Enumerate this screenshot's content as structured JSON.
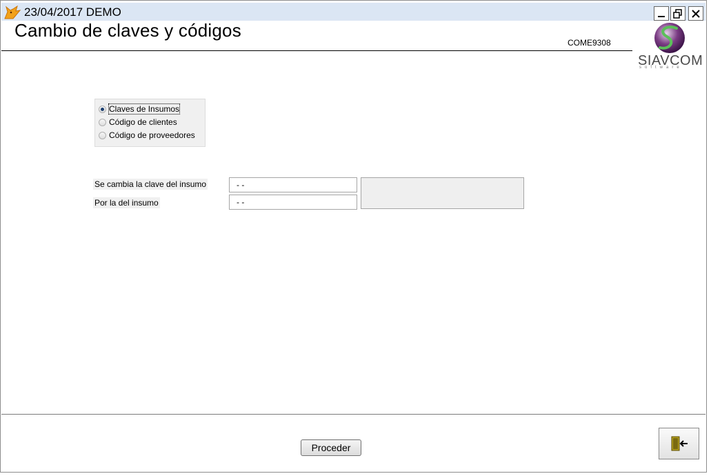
{
  "window": {
    "title": "23/04/2017  DEMO",
    "minimize_icon": "minimize-icon",
    "restore_icon": "restore-icon",
    "close_icon": "close-icon"
  },
  "header": {
    "page_title": "Cambio de claves y códigos",
    "form_code": "COME9308",
    "logo_text": "SIAVCOM",
    "logo_subtext": "software"
  },
  "options": {
    "items": [
      {
        "label": "Claves de Insumos",
        "checked": true
      },
      {
        "label": "Código de clientes",
        "checked": false
      },
      {
        "label": "Código de proveedores",
        "checked": false
      }
    ]
  },
  "form": {
    "from_label": "Se cambia la clave del insumo",
    "from_value": "- -",
    "to_label": "Por la del insumo",
    "to_value": "- -"
  },
  "footer": {
    "proceed_label": "Proceder",
    "exit_icon": "exit-door-icon"
  },
  "colors": {
    "titlebar": "#dbe6f4",
    "logo_purple": "#6a2c70",
    "logo_green": "#4caf50"
  }
}
